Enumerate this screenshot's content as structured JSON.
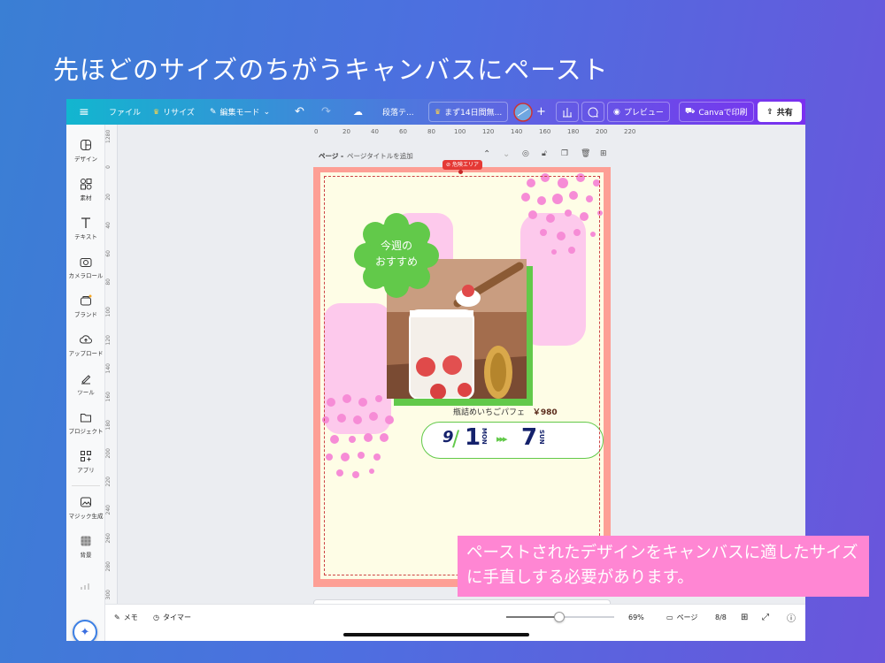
{
  "heading": "先ほどのサイズのちがうキャンバスにペースト",
  "topbar": {
    "file": "ファイル",
    "resize": "リサイズ",
    "edit_mode": "編集モード",
    "doc_title": "段落テ...",
    "trial": "まず14日間無...",
    "preview": "プレビュー",
    "print": "Canvaで印刷",
    "share": "共有"
  },
  "sidebar": {
    "items": [
      "デザイン",
      "素材",
      "テキスト",
      "カメラロール",
      "ブランド",
      "アップロード",
      "ツール",
      "プロジェクト",
      "アプリ",
      "マジック生成",
      "背景"
    ]
  },
  "ruler": {
    "h": [
      "0",
      "20",
      "40",
      "60",
      "80",
      "100",
      "120",
      "140",
      "160",
      "180",
      "200",
      "220"
    ],
    "v": [
      "0",
      "20",
      "40",
      "60",
      "80",
      "100",
      "120",
      "140",
      "160",
      "180",
      "200",
      "220",
      "240",
      "260",
      "280",
      "300"
    ]
  },
  "pagebar": {
    "label": "ページ -",
    "title_placeholder": "ページタイトルを追加",
    "danger_badge": "危険エリア"
  },
  "design": {
    "badge_line1": "今週の",
    "badge_line2": "おすすめ",
    "product": "瓶詰めいちごパフェ",
    "price": "￥980",
    "date_start_month": "9",
    "date_start_day": "1",
    "date_start_dow": "MON",
    "date_end_day": "7",
    "date_end_dow": "SUN",
    "arrows": "▸▸▸"
  },
  "bottombar": {
    "memo": "メモ",
    "timer": "タイマー",
    "zoom": "69%",
    "page_label": "ページ",
    "page_count": "8/8"
  },
  "callout": "ペーストされたデザインをキャンバスに適したサイズに手直しする必要があります。",
  "colors": {
    "accent_cyan": "#12b6cf",
    "accent_purple": "#7a2ff0",
    "page_border": "#fd9f95",
    "page_bg": "#fefde6",
    "green": "#62c94a",
    "pink": "#fdc9ec",
    "navy": "#14216b",
    "callout_bg": "#ff86d3"
  }
}
